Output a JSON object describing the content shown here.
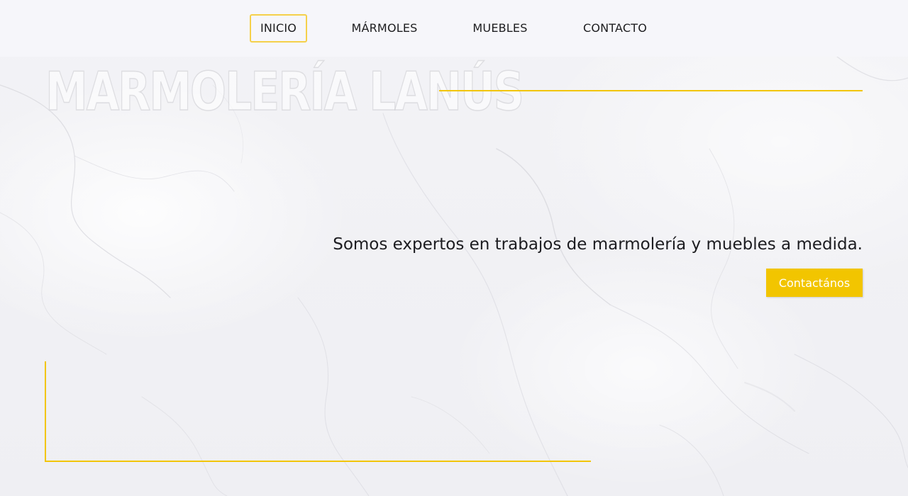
{
  "nav": {
    "items": [
      {
        "label": "INICIO",
        "active": true
      },
      {
        "label": "MÁRMOLES",
        "active": false
      },
      {
        "label": "MUEBLES",
        "active": false
      },
      {
        "label": "CONTACTO",
        "active": false
      }
    ]
  },
  "hero": {
    "title": "MARMOLERÍA LANÚS",
    "tagline": "Somos expertos en trabajos de marmolería y muebles a medida.",
    "cta_label": "Contactános"
  },
  "colors": {
    "accent": "#f2c500",
    "text": "#1c1c20",
    "background": "#f4f4f7"
  }
}
